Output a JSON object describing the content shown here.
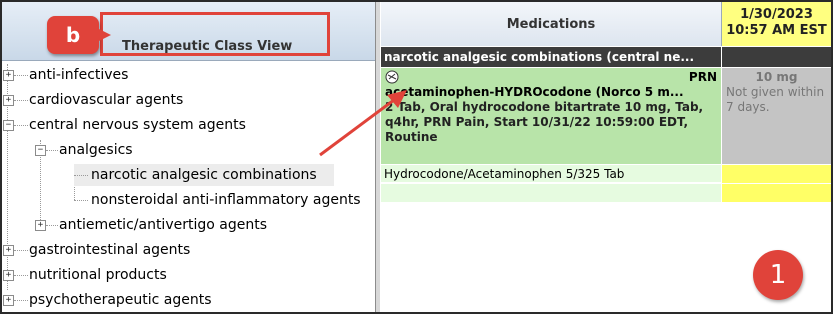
{
  "left_panel": {
    "header_title": "Therapeutic Class View",
    "callout_label": "b",
    "tree": [
      {
        "label": "anti-infectives",
        "expander": "+"
      },
      {
        "label": "cardiovascular agents",
        "expander": "+"
      },
      {
        "label": "central nervous system agents",
        "expander": "−"
      },
      {
        "label": "analgesics",
        "expander": "−"
      },
      {
        "label": "narcotic analgesic combinations",
        "expander": ""
      },
      {
        "label": "nonsteroidal anti-inflammatory agents",
        "expander": ""
      },
      {
        "label": "antiemetic/antivertigo agents",
        "expander": "+"
      },
      {
        "label": "gastrointestinal agents",
        "expander": "+"
      },
      {
        "label": "nutritional products",
        "expander": "+"
      },
      {
        "label": "psychotherapeutic agents",
        "expander": "+"
      }
    ]
  },
  "grid": {
    "medications_header": "Medications",
    "date_header": {
      "date": "1/30/2023",
      "time": "10:57 AM EST"
    },
    "group_row": "narcotic analgesic combinations  (central ne...",
    "med": {
      "prn": "PRN",
      "name": "acetaminophen-HYDROcodone (Norco 5 m...",
      "detail": "2 Tab, Oral hydrocodone bitartrate 10 mg, Tab, q4hr, PRN Pain, Start 10/31/22 10:59:00 EDT, Routine",
      "dose": "10 mg",
      "status": "Not given within 7 days."
    },
    "row2_text": "Hydrocodone/Acetaminophen 5/325 Tab"
  },
  "callout_1": "1",
  "colors": {
    "accent_red": "#e0433a",
    "med_green": "#b8e4a9",
    "date_yellow": "#ffff80",
    "group_dark": "#3c3c3c"
  }
}
